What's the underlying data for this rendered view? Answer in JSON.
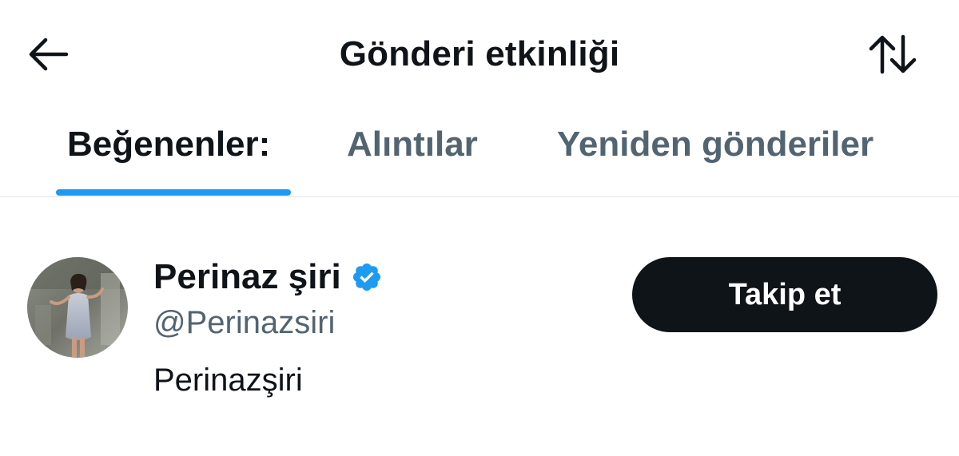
{
  "header": {
    "title": "Gönderi etkinliği",
    "back_icon": "arrow-left-icon",
    "sort_icon": "sort-arrows-icon"
  },
  "tabs": [
    {
      "label": "Beğenenler:",
      "active": true
    },
    {
      "label": "Alıntılar",
      "active": false
    },
    {
      "label": "Yeniden gönderiler",
      "active": false
    }
  ],
  "user": {
    "name": "Perinaz şiri",
    "verified": true,
    "handle": "@Perinazsiri",
    "bio": "Perinazşiri",
    "follow_label": "Takip et"
  },
  "colors": {
    "accent": "#1d9bf0",
    "text_primary": "#0f1419",
    "text_secondary": "#536471",
    "divider": "#dfe4e8"
  }
}
